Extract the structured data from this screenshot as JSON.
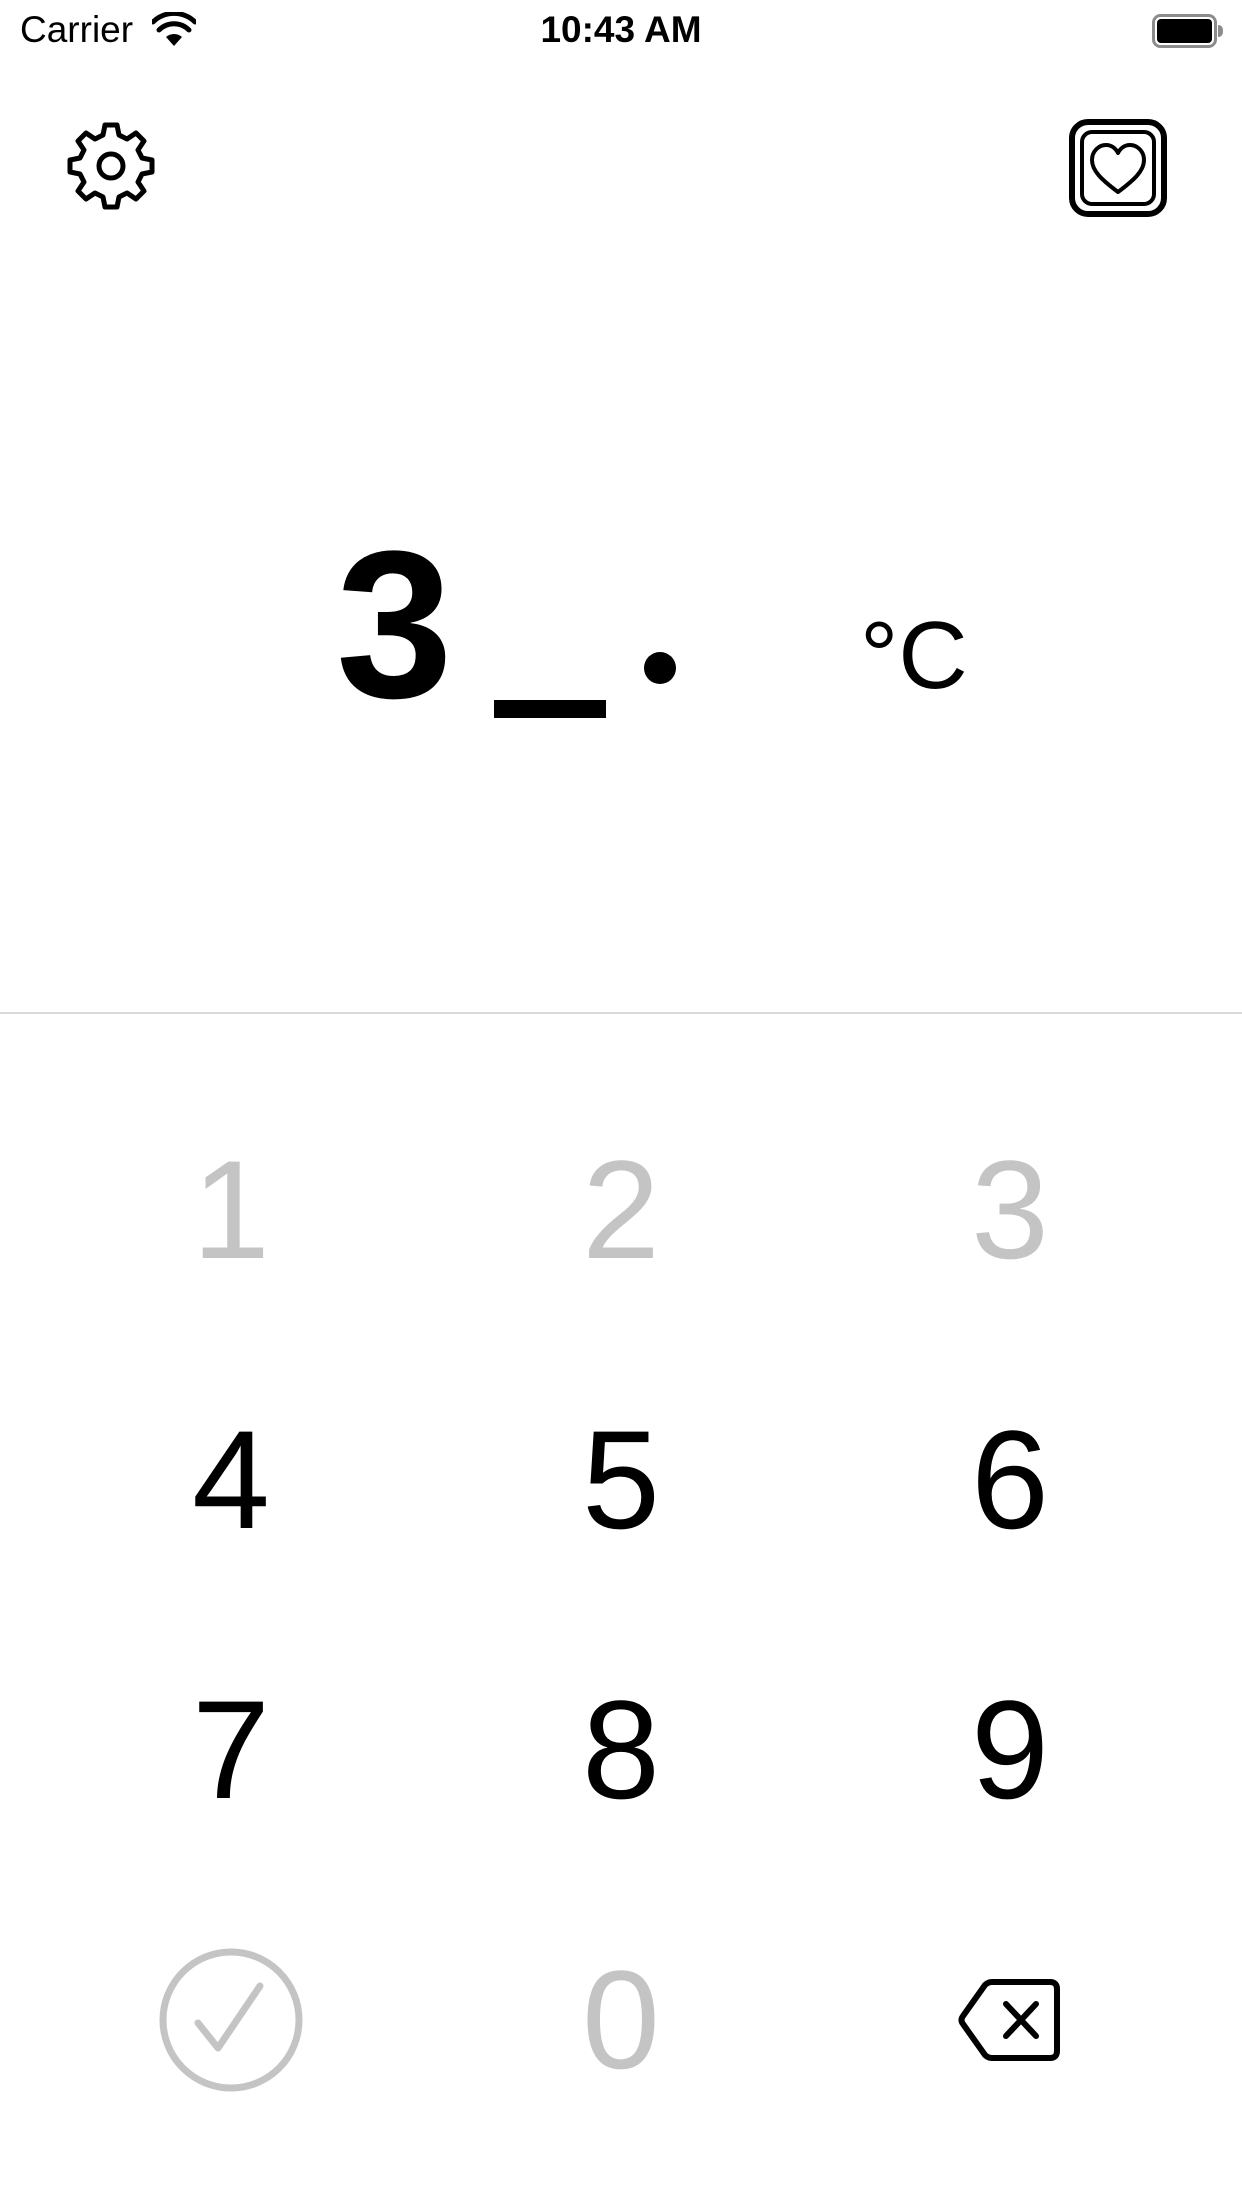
{
  "status_bar": {
    "carrier": "Carrier",
    "time": "10:43 AM",
    "wifi_icon": "wifi-icon",
    "battery_icon": "battery-full-icon"
  },
  "toolbar": {
    "settings_icon": "gear-icon",
    "favorites_icon": "heart-square-icon"
  },
  "display": {
    "entered_value": "3",
    "placeholder_digit": "_",
    "decimal_separator": ".",
    "unit": "°C"
  },
  "keypad": {
    "keys": [
      {
        "label": "1",
        "enabled": false
      },
      {
        "label": "2",
        "enabled": false
      },
      {
        "label": "3",
        "enabled": false
      },
      {
        "label": "4",
        "enabled": true
      },
      {
        "label": "5",
        "enabled": true
      },
      {
        "label": "6",
        "enabled": true
      },
      {
        "label": "7",
        "enabled": true
      },
      {
        "label": "8",
        "enabled": true
      },
      {
        "label": "9",
        "enabled": true
      },
      {
        "label": "0",
        "enabled": false
      }
    ],
    "confirm_icon": "checkmark-circle-icon",
    "confirm_enabled": false,
    "delete_icon": "delete-backspace-icon",
    "delete_enabled": true
  },
  "colors": {
    "enabled_key": "#000000",
    "disabled_key": "#c4c4c4",
    "divider": "#d9d9d9",
    "background": "#ffffff"
  }
}
